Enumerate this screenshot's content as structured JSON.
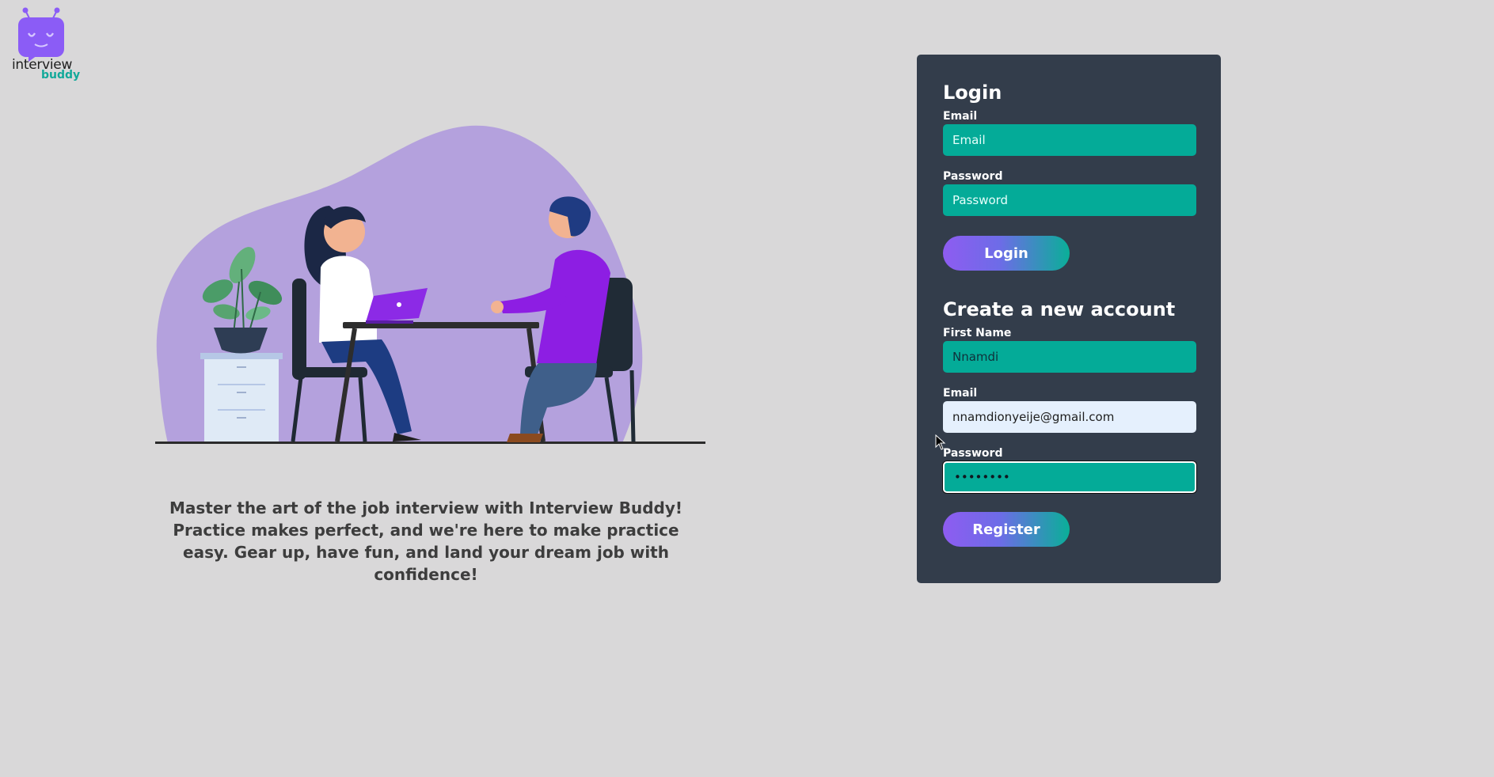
{
  "brand": {
    "name": "interview",
    "sub": "buddy"
  },
  "hero": {
    "tagline": "Master the art of the job interview with Interview Buddy! Practice makes perfect, and we're here to make practice easy. Gear up, have fun, and land your dream job with confidence!"
  },
  "login": {
    "heading": "Login",
    "email_label": "Email",
    "email_placeholder": "Email",
    "email_value": "",
    "password_label": "Password",
    "password_placeholder": "Password",
    "password_value": "",
    "button_label": "Login"
  },
  "register": {
    "heading": "Create a new account",
    "first_name_label": "First Name",
    "first_name_value": "Nnamdi",
    "email_label": "Email",
    "email_value": "nnamdionyeije@gmail.com",
    "password_label": "Password",
    "password_value": "nnamdi12",
    "button_label": "Register"
  },
  "colors": {
    "page_bg": "#d9d8d9",
    "card_bg": "#333d4b",
    "input_bg": "#04ab98",
    "autofill_bg": "#e5f0fd",
    "accent_purple": "#8e5cf1",
    "accent_teal": "#0aaf98"
  },
  "icons": {
    "logo": "robot-chat-icon",
    "cursor": "mouse-pointer-icon"
  }
}
